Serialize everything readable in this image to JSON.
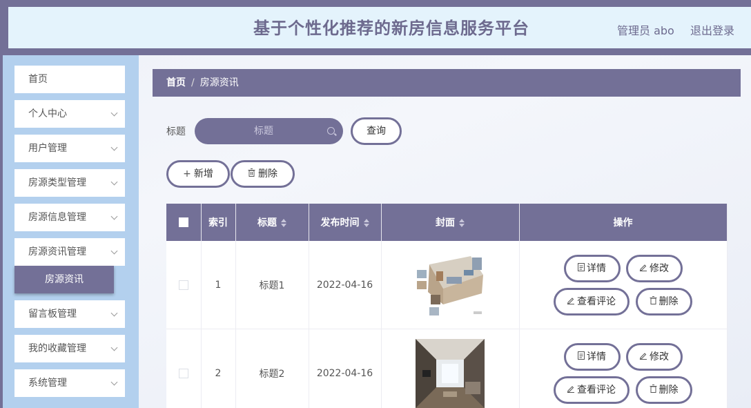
{
  "header": {
    "title": "基于个性化推荐的新房信息服务平台",
    "admin_label": "管理员 abo",
    "logout_label": "退出登录"
  },
  "sidebar": {
    "items": [
      {
        "label": "首页"
      },
      {
        "label": "个人中心"
      },
      {
        "label": "用户管理"
      },
      {
        "label": "房源类型管理"
      },
      {
        "label": "房源信息管理"
      },
      {
        "label": "房源资讯管理"
      },
      {
        "label": "留言板管理"
      },
      {
        "label": "我的收藏管理"
      },
      {
        "label": "系统管理"
      }
    ],
    "active_sub": "房源资讯"
  },
  "breadcrumb": {
    "home": "首页",
    "separator": "/",
    "current": "房源资讯"
  },
  "search": {
    "label": "标题",
    "placeholder": "标题",
    "query_label": "查询"
  },
  "actions": {
    "add_label": "新增",
    "delete_label": "删除"
  },
  "table": {
    "columns": [
      "索引",
      "标题",
      "发布时间",
      "封面",
      "操作"
    ],
    "rows": [
      {
        "index": "1",
        "title": "标题1",
        "date": "2022-04-16"
      },
      {
        "index": "2",
        "title": "标题2",
        "date": "2022-04-16"
      }
    ],
    "ops": {
      "detail": "详情",
      "edit": "修改",
      "comments": "查看评论",
      "delete": "删除"
    }
  },
  "colors": {
    "primary": "#737097",
    "sidebar_bg": "#b3d0ee",
    "header_bg": "#e4f3fc"
  }
}
